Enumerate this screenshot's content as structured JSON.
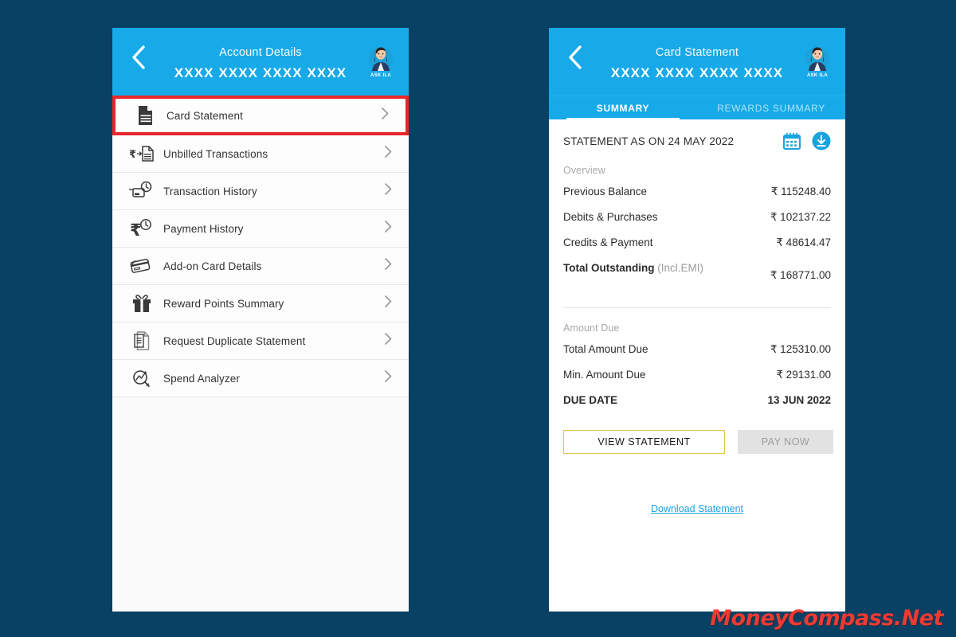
{
  "colors": {
    "page_background": "#084163",
    "header_blue": "#17a9e8",
    "accent_blue": "#19a3e0",
    "highlight_red": "#e8262a",
    "view_button_border": "#e3c64a",
    "disabled_grey": "#e2e2e2"
  },
  "left_screen": {
    "header": {
      "title": "Account Details",
      "card_number": "XXXX XXXX XXXX XXXX",
      "back_icon": "chevron-left-icon",
      "avatar_label": "ASK ILA"
    },
    "menu": [
      {
        "label": "Card Statement",
        "icon": "document-lines-icon",
        "highlighted": true
      },
      {
        "label": "Unbilled Transactions",
        "icon": "rupee-document-icon",
        "highlighted": false
      },
      {
        "label": "Transaction History",
        "icon": "card-clock-icon",
        "highlighted": false
      },
      {
        "label": "Payment History",
        "icon": "rupee-clock-icon",
        "highlighted": false
      },
      {
        "label": "Add-on Card Details",
        "icon": "credit-cards-icon",
        "highlighted": false
      },
      {
        "label": "Reward Points Summary",
        "icon": "gift-icon",
        "highlighted": false
      },
      {
        "label": "Request Duplicate Statement",
        "icon": "duplicate-document-icon",
        "highlighted": false
      },
      {
        "label": "Spend Analyzer",
        "icon": "analytics-magnifier-icon",
        "highlighted": false
      }
    ],
    "chevron_icon": "chevron-right-icon"
  },
  "right_screen": {
    "header": {
      "title": "Card Statement",
      "card_number": "XXXX XXXX XXXX XXXX",
      "back_icon": "chevron-left-icon",
      "avatar_label": "ASK ILA"
    },
    "tabs": [
      {
        "label": "SUMMARY",
        "active": true
      },
      {
        "label": "REWARDS SUMMARY",
        "active": false
      }
    ],
    "statement_as_on": "STATEMENT AS ON 24 MAY 2022",
    "calendar_icon": "calendar-icon",
    "download_icon": "download-circle-icon",
    "overview": {
      "label": "Overview",
      "rows": [
        {
          "label": "Previous Balance",
          "value": "₹ 115248.40"
        },
        {
          "label": "Debits & Purchases",
          "value": "₹ 102137.22"
        },
        {
          "label": "Credits & Payment",
          "value": "₹ 48614.47"
        }
      ],
      "total": {
        "label": "Total Outstanding",
        "sub_label": " (Incl.EMI)",
        "value": "₹ 168771.00"
      }
    },
    "amount_due": {
      "label": "Amount Due",
      "rows": [
        {
          "label": "Total Amount Due",
          "value": "₹ 125310.00"
        },
        {
          "label": "Min. Amount Due",
          "value": "₹ 29131.00"
        }
      ],
      "due_date": {
        "label": "DUE DATE",
        "value": "13 JUN 2022"
      }
    },
    "buttons": {
      "view_statement": "VIEW STATEMENT",
      "pay_now": "PAY NOW"
    },
    "download_link": "Download Statement"
  },
  "watermark": "MoneyCompass.Net"
}
